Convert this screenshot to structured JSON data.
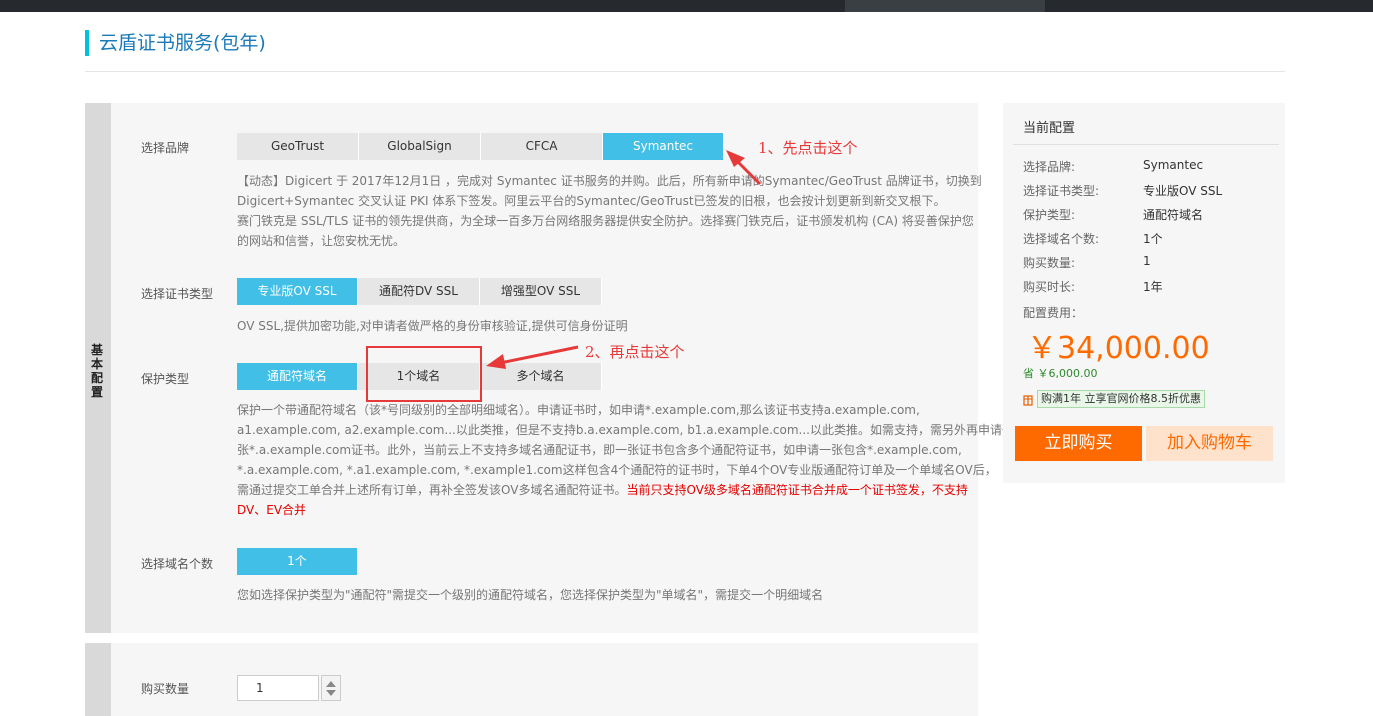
{
  "page": {
    "title": "云盾证书服务(包年)"
  },
  "panel": {
    "side_label": "基本配置"
  },
  "brand": {
    "label": "选择品牌",
    "options": [
      "GeoTrust",
      "GlobalSign",
      "CFCA",
      "Symantec"
    ],
    "selected": "Symantec",
    "desc_lines": [
      "【动态】Digicert 于 2017年12月1日 ，完成对 Symantec 证书服务的并购。此后，所有新申请的Symantec/GeoTrust 品牌证书，切换到",
      "Digicert+Symantec 交叉认证 PKI 体系下签发。阿里云平台的Symantec/GeoTrust已签发的旧根，也会按计划更新到新交叉根下。",
      "赛门铁克是 SSL/TLS 证书的领先提供商，为全球一百多万台网络服务器提供安全防护。选择赛门铁克后，证书颁发机构 (CA) 将妥善保护您",
      "的网站和信誉，让您安枕无忧。"
    ]
  },
  "cert_type": {
    "label": "选择证书类型",
    "options": [
      "专业版OV SSL",
      "通配符DV SSL",
      "增强型OV SSL"
    ],
    "selected": "专业版OV SSL",
    "desc": "OV SSL,提供加密功能,对申请者做严格的身份审核验证,提供可信身份证明"
  },
  "protect_type": {
    "label": "保护类型",
    "options": [
      "通配符域名",
      "1个域名",
      "多个域名"
    ],
    "selected": "通配符域名",
    "desc_lines": [
      "保护一个带通配符域名（该*号同级别的全部明细域名）。申请证书时，如申请*.example.com,那么该证书支持a.example.com,",
      "a1.example.com, a2.example.com...以此类推，但是不支持b.a.example.com, b1.a.example.com...以此类推。如需支持，需另外再申请一",
      "张*.a.example.com证书。此外，当前云上不支持多域名通配证书，即一张证书包含多个通配符证书，如申请一张包含*.example.com,",
      "*.a.example.com, *.a1.example.com, *.example1.com这样包含4个通配符的证书时，下单4个OV专业版通配符订单及一个单域名OV后，"
    ],
    "desc_line5": "需通过提交工单合并上述所有订单，再补全签发该OV多域名通配符证书。",
    "desc_red_a": "当前只支持OV级多域名通配符证书合并成一个证书签发，不支持",
    "desc_red_b": "DV、EV合并"
  },
  "domain_count": {
    "label": "选择域名个数",
    "options": [
      "1个"
    ],
    "selected": "1个",
    "desc": "您如选择保护类型为\"通配符\"需提交一个级别的通配符域名，您选择保护类型为\"单域名\"，需提交一个明细域名"
  },
  "purchase": {
    "qty_label": "购买数量",
    "qty_value": "1"
  },
  "annotations": {
    "note1": "1、先点击这个",
    "note2": "2、再点击这个",
    "color": "#e63939"
  },
  "config": {
    "title": "当前配置",
    "rows": [
      {
        "k": "选择品牌:",
        "v": "Symantec"
      },
      {
        "k": "选择证书类型:",
        "v": "专业版OV SSL"
      },
      {
        "k": "保护类型:",
        "v": "通配符域名"
      },
      {
        "k": "选择域名个数:",
        "v": "1个"
      },
      {
        "k": "购买数量:",
        "v": "1"
      },
      {
        "k": "购买时长:",
        "v": "1年"
      }
    ],
    "fee_label": "配置费用：",
    "price": "￥34,000.00",
    "save_icon": "省",
    "save": "￥6,000.00",
    "promo": "购满1年 立享官网价格8.5折优惠",
    "buy_label": "立即购买",
    "cart_label": "加入购物车",
    "accent": "#ff6a00"
  },
  "colors": {
    "selected": "#42bfe6",
    "title_bar": "#00c1de"
  }
}
